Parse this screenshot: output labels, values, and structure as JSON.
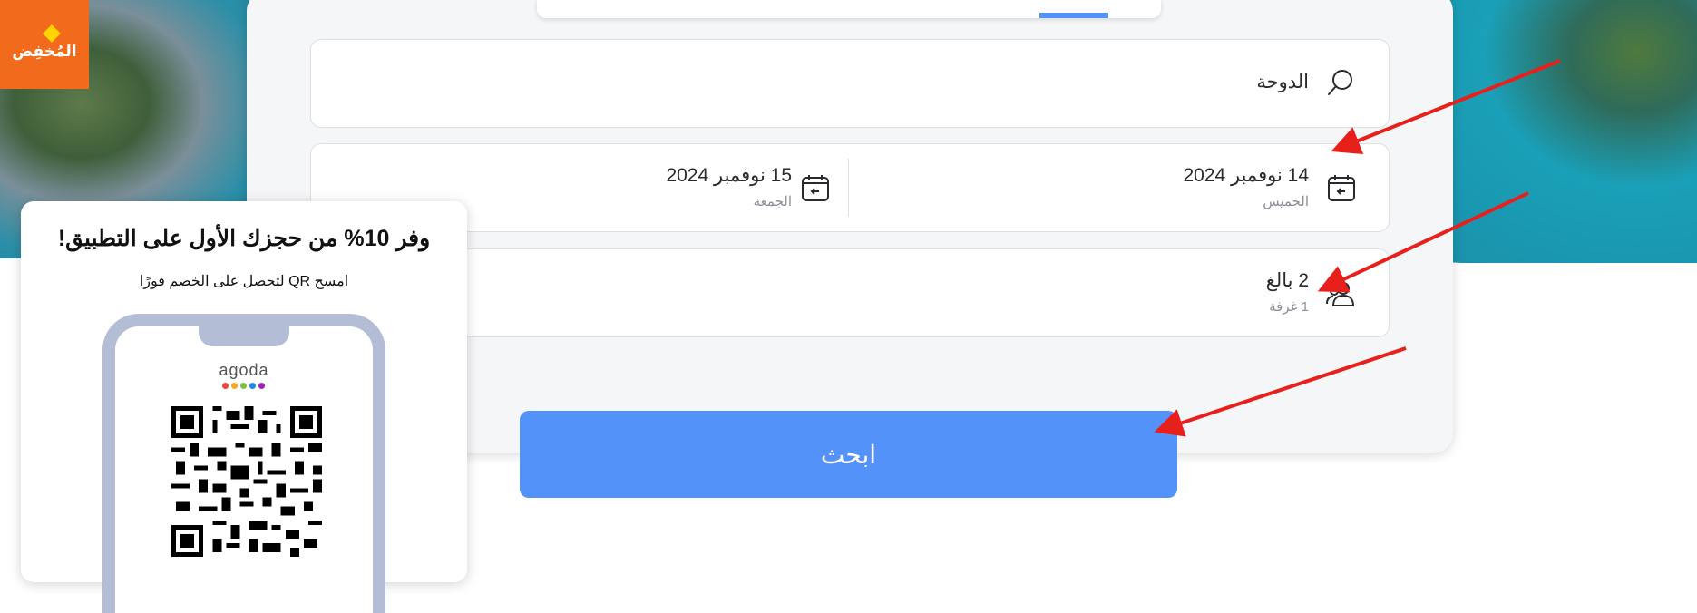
{
  "brand": {
    "logo_text": "المُخفِض",
    "logo_color": "#f26b1d"
  },
  "search": {
    "destination": "الدوحة"
  },
  "dates": {
    "checkin": {
      "date": "14 نوفمبر 2024",
      "day": "الخميس"
    },
    "checkout": {
      "date": "15 نوفمبر 2024",
      "day": "الجمعة"
    }
  },
  "guests": {
    "adults": "2 بالغ",
    "rooms": "1 غرفة"
  },
  "search_button": {
    "label": "ابحث",
    "color": "#5392f9"
  },
  "promo": {
    "title": "وفر 10% من حجزك الأول على التطبيق!",
    "subtitle": "امسح QR لتحصل على الخصم فورًا",
    "app_brand": "agoda",
    "dot_colors": [
      "#e9443d",
      "#f5a623",
      "#7ac143",
      "#1e88e5",
      "#9c27b0"
    ]
  },
  "annotations": {
    "arrow_color": "#e8201c",
    "arrow_count": 3
  }
}
